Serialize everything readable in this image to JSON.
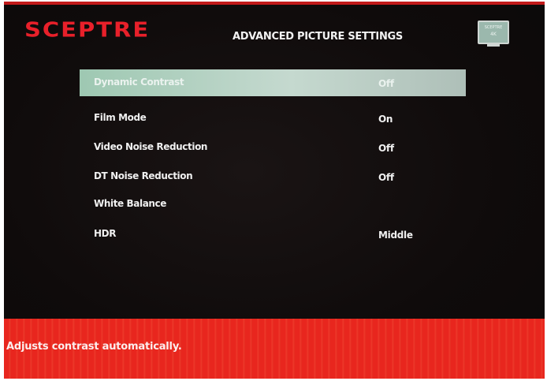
{
  "brand": {
    "logo_text": "SCEPTRE",
    "tv_icon_brand": "SCEPTRE",
    "tv_icon_resolution": "4K",
    "accent_color": "#e8202a"
  },
  "header": {
    "title": "ADVANCED PICTURE SETTINGS"
  },
  "menu": {
    "selected_index": 0,
    "items": [
      {
        "label": "Dynamic Contrast",
        "value": "Off"
      },
      {
        "label": "Film Mode",
        "value": "On"
      },
      {
        "label": "Video Noise Reduction",
        "value": "Off"
      },
      {
        "label": "DT Noise Reduction",
        "value": "Off"
      },
      {
        "label": "White Balance",
        "value": ""
      },
      {
        "label": "HDR",
        "value": "Middle"
      }
    ]
  },
  "footer": {
    "help_text": "Adjusts contrast automatically."
  }
}
